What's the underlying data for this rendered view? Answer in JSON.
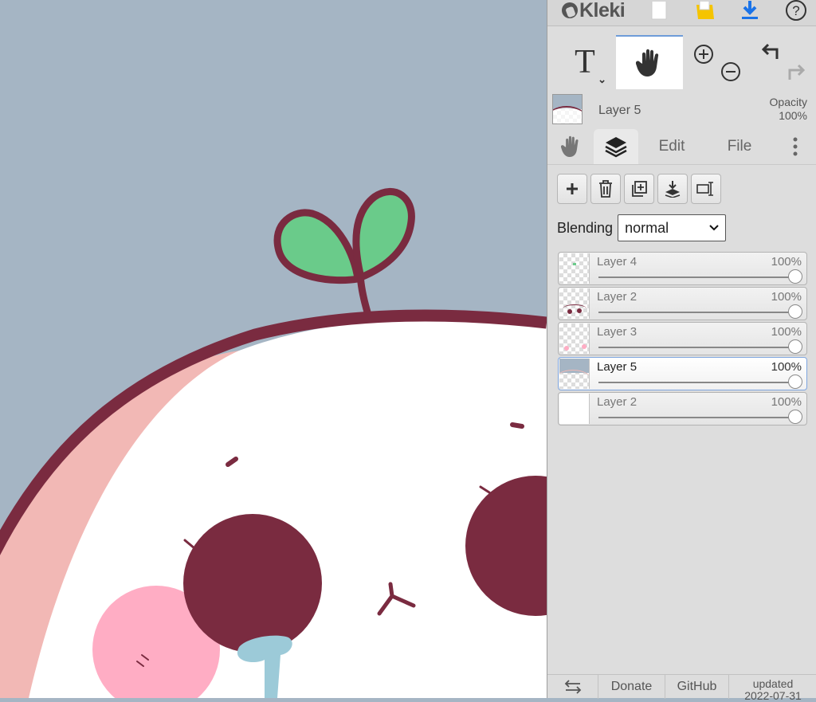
{
  "app": {
    "name": "Kleki"
  },
  "topbar": {
    "icons": [
      "new-image-icon",
      "open-folder-icon",
      "download-icon",
      "help-icon"
    ],
    "colors": {
      "folder": "#f5c400",
      "download": "#1a73e8"
    }
  },
  "tools": {
    "text_tool_label": "T",
    "hand_tool": "hand-icon",
    "zoom_in": "zoom-in-icon",
    "zoom_out": "zoom-out-icon",
    "undo": "undo-icon",
    "redo": "redo-icon"
  },
  "current_layer": {
    "name": "Layer 5",
    "opacity_label": "Opacity",
    "opacity_value": "100%"
  },
  "tabs": [
    {
      "id": "hand",
      "icon": "hand-icon"
    },
    {
      "id": "layers",
      "icon": "layers-icon",
      "active": true
    },
    {
      "id": "edit",
      "label": "Edit"
    },
    {
      "id": "file",
      "label": "File"
    },
    {
      "id": "more",
      "icon": "more-vertical-icon"
    }
  ],
  "layer_buttons": [
    "add-layer-icon",
    "delete-layer-icon",
    "duplicate-layer-icon",
    "merge-down-icon",
    "rename-layer-icon"
  ],
  "blending": {
    "label": "Blending",
    "value": "normal"
  },
  "layers": [
    {
      "name": "Layer 4",
      "opacity": "100%",
      "selected": false
    },
    {
      "name": "Layer 2",
      "opacity": "100%",
      "selected": false
    },
    {
      "name": "Layer 3",
      "opacity": "100%",
      "selected": false
    },
    {
      "name": "Layer 5",
      "opacity": "100%",
      "selected": true
    },
    {
      "name": "Layer 2",
      "opacity": "100%",
      "selected": false
    }
  ],
  "footer": {
    "swap": "swap-icon",
    "donate": "Donate",
    "github": "GitHub",
    "updated_label": "updated",
    "updated_date": "2022-07-31"
  },
  "colors": {
    "canvas_bg": "#a5b5c4",
    "outline": "#7a2b40",
    "leaf": "#6acb8a",
    "blush": "#ffadc4",
    "cheek_shadow": "#f2b8b5",
    "drip": "#9ccad8"
  }
}
